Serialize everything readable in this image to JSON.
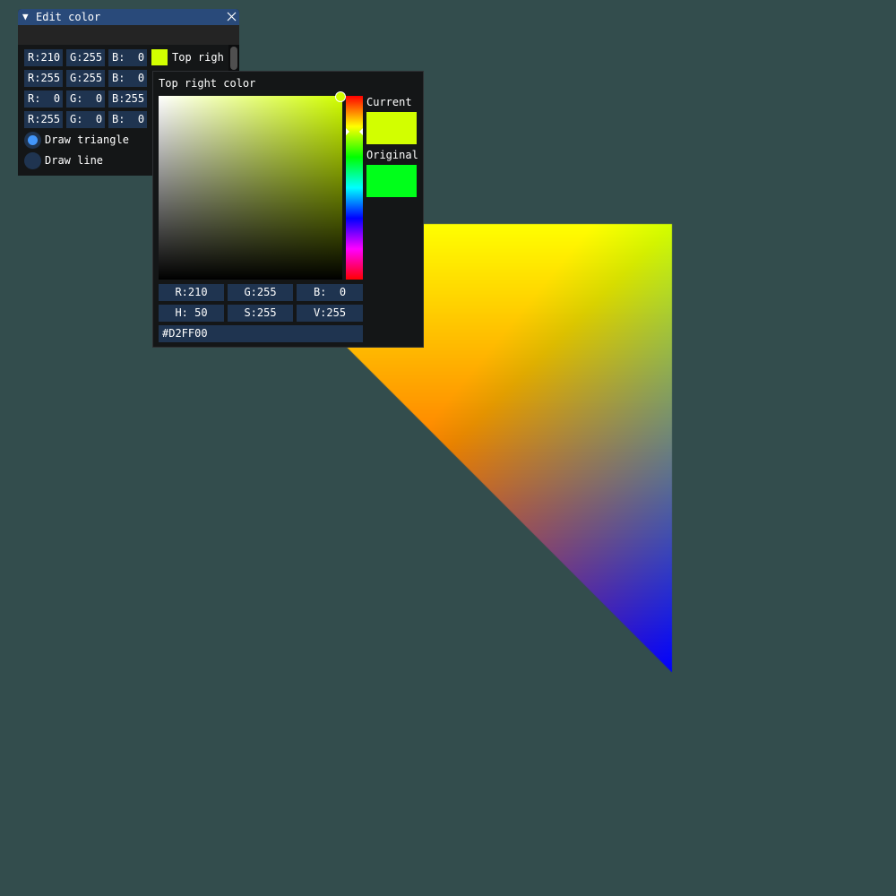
{
  "window": {
    "title": "Edit color",
    "title_arrow": "▼",
    "rows": [
      {
        "r": "R:210",
        "g": "G:255",
        "b": "B:  0",
        "swatch": "#d2ff00",
        "label": "Top righ"
      },
      {
        "r": "R:255",
        "g": "G:255",
        "b": "B:  0"
      },
      {
        "r": "R:  0",
        "g": "G:  0",
        "b": "B:255"
      },
      {
        "r": "R:255",
        "g": "G:  0",
        "b": "B:  0"
      }
    ],
    "radio_draw_triangle": "Draw triangle",
    "radio_draw_line": "Draw line",
    "selected_mode": "Draw triangle"
  },
  "picker": {
    "title": "Top right color",
    "current_label": "Current",
    "original_label": "Original",
    "current_color": "#d2ff00",
    "original_color": "#00ff1a",
    "rgb": {
      "r": "R:210",
      "g": "G:255",
      "b": "B:  0"
    },
    "hsv": {
      "h": "H: 50",
      "s": "S:255",
      "v": "V:255"
    },
    "hex": "#D2FF00"
  },
  "triangle": {
    "top_right_color": "#d2ff00",
    "bottom_left_color": "#ff0000",
    "bottom_right_color": "#0000ff"
  },
  "colors": {
    "background": "#334d4d",
    "window_bg": "#141617",
    "titlebar": "#294a7a",
    "frame": "#1f3450",
    "accent": "#4296fa"
  }
}
